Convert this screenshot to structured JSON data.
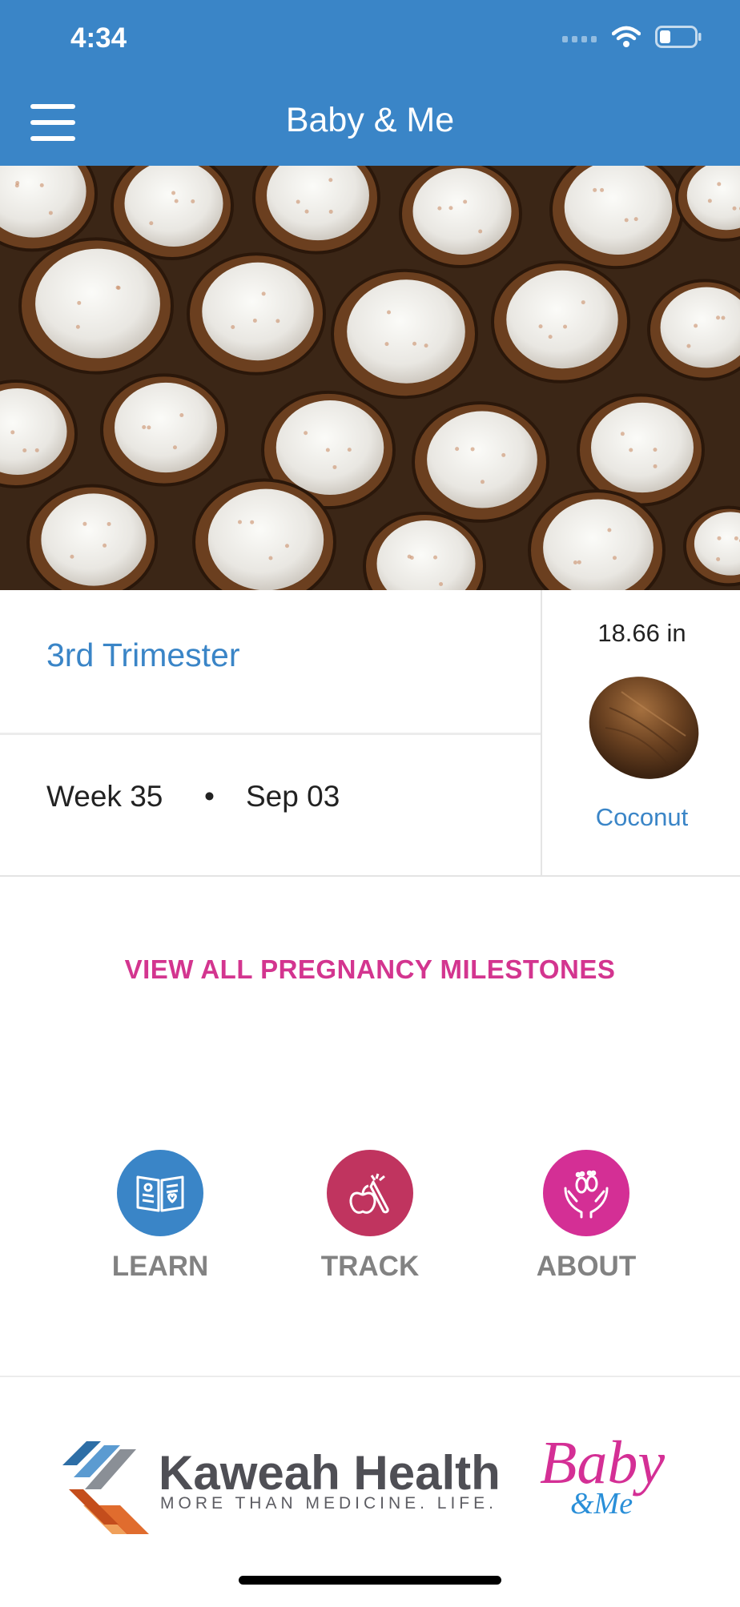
{
  "status_bar": {
    "time": "4:34"
  },
  "header": {
    "title": "Baby & Me"
  },
  "current": {
    "trimester": "3rd Trimester",
    "week": "Week 35",
    "separator": "•",
    "date": "Sep 03"
  },
  "size": {
    "length": "18.66 in",
    "fruit": "Coconut"
  },
  "milestones_link": "VIEW ALL PREGNANCY MILESTONES",
  "actions": [
    {
      "label": "LEARN",
      "color": "#3a85c7"
    },
    {
      "label": "TRACK",
      "color": "#c0345f"
    },
    {
      "label": "ABOUT",
      "color": "#d42f95"
    }
  ],
  "footer": {
    "brand_name": "Kaweah Health",
    "brand_tagline": "MORE THAN MEDICINE. LIFE.",
    "app_logo_main": "Baby",
    "app_logo_sub": "&Me"
  },
  "colors": {
    "header_blue": "#3a85c7",
    "accent_pink": "#d3358f"
  }
}
